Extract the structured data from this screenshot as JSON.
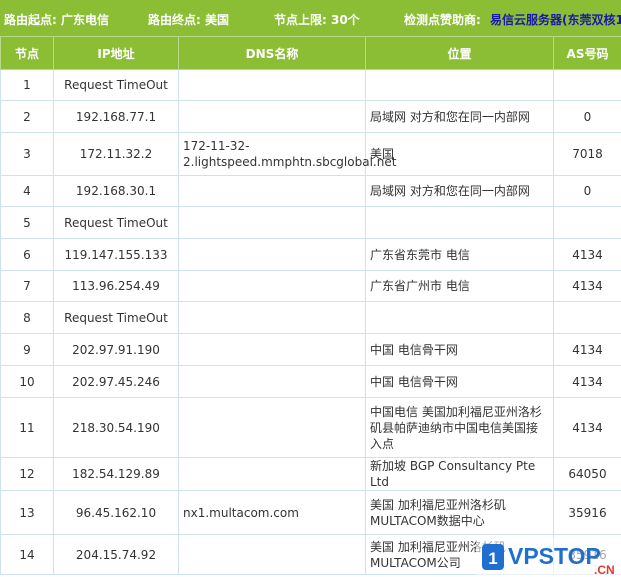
{
  "header": {
    "source_label": "路由起点: 广东电信",
    "dest_label": "路由终点: 美国",
    "hops_label": "节点上限: 30个",
    "sponsor_label": "检测点赞助商:",
    "sponsor_link": "易信云服务器",
    "sponsor_suffix": "(东莞双核1"
  },
  "columns": [
    "节点",
    "IP地址",
    "DNS名称",
    "位置",
    "AS号码"
  ],
  "rows": [
    {
      "hop": "1",
      "ip": "Request TimeOut",
      "dns": "",
      "location": "",
      "as": ""
    },
    {
      "hop": "2",
      "ip": "192.168.77.1",
      "dns": "",
      "location": "局域网 对方和您在同一内部网",
      "as": "0"
    },
    {
      "hop": "3",
      "ip": "172.11.32.2",
      "dns": "172-11-32-2.lightspeed.mmphtn.sbcglobal.net",
      "location": "美国",
      "as": "7018"
    },
    {
      "hop": "4",
      "ip": "192.168.30.1",
      "dns": "",
      "location": "局域网 对方和您在同一内部网",
      "as": "0"
    },
    {
      "hop": "5",
      "ip": "Request TimeOut",
      "dns": "",
      "location": "",
      "as": ""
    },
    {
      "hop": "6",
      "ip": "119.147.155.133",
      "dns": "",
      "location": "广东省东莞市 电信",
      "as": "4134"
    },
    {
      "hop": "7",
      "ip": "113.96.254.49",
      "dns": "",
      "location": "广东省广州市 电信",
      "as": "4134"
    },
    {
      "hop": "8",
      "ip": "Request TimeOut",
      "dns": "",
      "location": "",
      "as": ""
    },
    {
      "hop": "9",
      "ip": "202.97.91.190",
      "dns": "",
      "location": "中国 电信骨干网",
      "as": "4134"
    },
    {
      "hop": "10",
      "ip": "202.97.45.246",
      "dns": "",
      "location": "中国 电信骨干网",
      "as": "4134"
    },
    {
      "hop": "11",
      "ip": "218.30.54.190",
      "dns": "",
      "location": "中国电信 美国加利福尼亚州洛杉矶县帕萨迪纳市中国电信美国接入点",
      "as": "4134"
    },
    {
      "hop": "12",
      "ip": "182.54.129.89",
      "dns": "",
      "location": "新加坡 BGP Consultancy Pte Ltd",
      "as": "64050"
    },
    {
      "hop": "13",
      "ip": "96.45.162.10",
      "dns": "nx1.multacom.com",
      "location": "美国 加利福尼亚州洛杉矶MULTACOM数据中心",
      "as": "35916"
    },
    {
      "hop": "14",
      "ip": "204.15.74.92",
      "dns": "",
      "location": "美国 加利福尼亚州洛杉矶MULTACOM公司",
      "as": "35916"
    }
  ],
  "watermark": {
    "text": "VPSTOP",
    "suffix": ".CN",
    "badge": "1"
  },
  "colors": {
    "header_green": "#8cbe35",
    "link_blue": "#1a1aa8",
    "watermark_blue": "#1f6fd0",
    "watermark_red": "#e03a2f"
  }
}
